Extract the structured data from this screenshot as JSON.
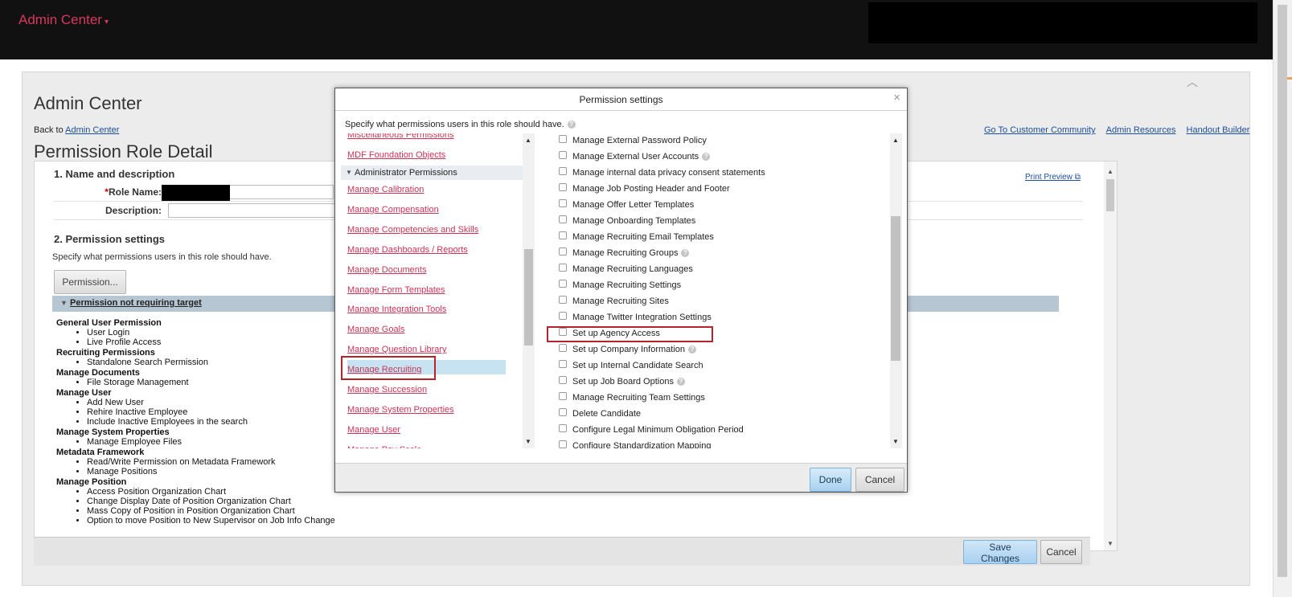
{
  "topbar": {
    "brand": "Admin Center",
    "brand_caret": "▾"
  },
  "page": {
    "title": "Admin Center",
    "back_prefix": "Back to",
    "back_link": "Admin Center",
    "links": [
      "Go To Customer Community",
      "Admin Resources",
      "Handout Builder"
    ],
    "role_title": "Permission Role Detail"
  },
  "section1": {
    "title": "1. Name and description",
    "print_preview": "Print Preview",
    "role_name_label": "Role Name:",
    "description_label": "Description:"
  },
  "section2": {
    "title": "2. Permission settings",
    "subtext": "Specify what permissions users in this role should have.",
    "permission_button": "Permission...",
    "bar_label": "Permission not requiring target",
    "groups": [
      {
        "name": "General User Permission",
        "items": [
          "User Login",
          "Live Profile Access"
        ]
      },
      {
        "name": "Recruiting Permissions",
        "items": [
          "Standalone Search Permission"
        ]
      },
      {
        "name": "Manage Documents",
        "items": [
          "File Storage Management"
        ]
      },
      {
        "name": "Manage User",
        "items": [
          "Add New User",
          "Rehire Inactive Employee",
          "Include Inactive Employees in the search"
        ]
      },
      {
        "name": "Manage System Properties",
        "items": [
          "Manage Employee Files"
        ]
      },
      {
        "name": "Metadata Framework",
        "items": [
          "Read/Write Permission on Metadata Framework",
          "Manage Positions"
        ]
      },
      {
        "name": "Manage Position",
        "items": [
          "Access Position Organization Chart",
          "Change Display Date of Position Organization Chart",
          "Mass Copy of Position in Position Organization Chart",
          "Option to move Position to New Supervisor on Job Info Change"
        ]
      }
    ]
  },
  "footer": {
    "save": "Save Changes",
    "cancel": "Cancel"
  },
  "modal": {
    "title": "Permission settings",
    "close": "×",
    "desc": "Specify what permissions users in this role should have.",
    "left_top_items": [
      "Miscellaneous Permissions",
      "MDF Foundation Objects"
    ],
    "left_header": "Administrator Permissions",
    "left_items": [
      "Manage Calibration",
      "Manage Compensation",
      "Manage Competencies and Skills",
      "Manage Dashboards / Reports",
      "Manage Documents",
      "Manage Form Templates",
      "Manage Integration Tools",
      "Manage Goals",
      "Manage Question Library",
      "Manage Recruiting",
      "Manage Succession",
      "Manage System Properties",
      "Manage User",
      "Manage Pay Scale"
    ],
    "right_items": [
      {
        "label": "Manage External Password Policy",
        "help": false
      },
      {
        "label": "Manage External User Accounts",
        "help": true
      },
      {
        "label": "Manage internal data privacy consent statements",
        "help": false
      },
      {
        "label": "Manage Job Posting Header and Footer",
        "help": false
      },
      {
        "label": "Manage Offer Letter Templates",
        "help": false
      },
      {
        "label": "Manage Onboarding Templates",
        "help": false
      },
      {
        "label": "Manage Recruiting Email Templates",
        "help": false
      },
      {
        "label": "Manage Recruiting Groups",
        "help": true
      },
      {
        "label": "Manage Recruiting Languages",
        "help": false
      },
      {
        "label": "Manage Recruiting Settings",
        "help": false
      },
      {
        "label": "Manage Recruiting Sites",
        "help": false
      },
      {
        "label": "Manage Twitter Integration Settings",
        "help": false
      },
      {
        "label": "Set up Agency Access",
        "help": false
      },
      {
        "label": "Set up Company Information",
        "help": true
      },
      {
        "label": "Set up Internal Candidate Search",
        "help": false
      },
      {
        "label": "Set up Job Board Options",
        "help": true
      },
      {
        "label": "Manage Recruiting Team Settings",
        "help": false
      },
      {
        "label": "Delete Candidate",
        "help": false
      },
      {
        "label": "Configure Legal Minimum Obligation Period",
        "help": false
      },
      {
        "label": "Configure Standardization Mapping",
        "help": false
      }
    ],
    "done": "Done",
    "cancel": "Cancel"
  },
  "icons": {
    "help": "?",
    "up": "▲",
    "down": "▼",
    "collapse_tri": "▼",
    "chevron_up": "︿"
  },
  "colors": {
    "brand": "#d9385e",
    "link": "#1a4f99",
    "left_link": "#cc3355",
    "highlight": "#b92128"
  }
}
